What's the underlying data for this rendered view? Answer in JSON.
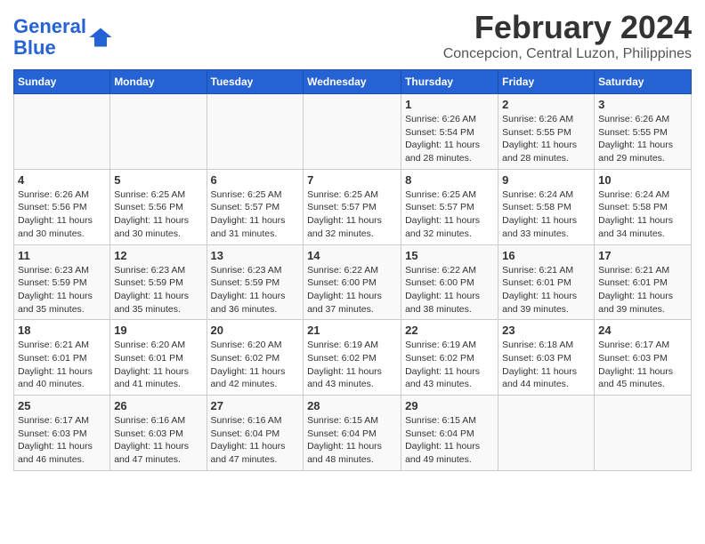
{
  "header": {
    "logo_line1": "General",
    "logo_line2": "Blue",
    "title": "February 2024",
    "subtitle": "Concepcion, Central Luzon, Philippines"
  },
  "days_of_week": [
    "Sunday",
    "Monday",
    "Tuesday",
    "Wednesday",
    "Thursday",
    "Friday",
    "Saturday"
  ],
  "weeks": [
    [
      {
        "day": "",
        "info": ""
      },
      {
        "day": "",
        "info": ""
      },
      {
        "day": "",
        "info": ""
      },
      {
        "day": "",
        "info": ""
      },
      {
        "day": "1",
        "info": "Sunrise: 6:26 AM\nSunset: 5:54 PM\nDaylight: 11 hours\nand 28 minutes."
      },
      {
        "day": "2",
        "info": "Sunrise: 6:26 AM\nSunset: 5:55 PM\nDaylight: 11 hours\nand 28 minutes."
      },
      {
        "day": "3",
        "info": "Sunrise: 6:26 AM\nSunset: 5:55 PM\nDaylight: 11 hours\nand 29 minutes."
      }
    ],
    [
      {
        "day": "4",
        "info": "Sunrise: 6:26 AM\nSunset: 5:56 PM\nDaylight: 11 hours\nand 30 minutes."
      },
      {
        "day": "5",
        "info": "Sunrise: 6:25 AM\nSunset: 5:56 PM\nDaylight: 11 hours\nand 30 minutes."
      },
      {
        "day": "6",
        "info": "Sunrise: 6:25 AM\nSunset: 5:57 PM\nDaylight: 11 hours\nand 31 minutes."
      },
      {
        "day": "7",
        "info": "Sunrise: 6:25 AM\nSunset: 5:57 PM\nDaylight: 11 hours\nand 32 minutes."
      },
      {
        "day": "8",
        "info": "Sunrise: 6:25 AM\nSunset: 5:57 PM\nDaylight: 11 hours\nand 32 minutes."
      },
      {
        "day": "9",
        "info": "Sunrise: 6:24 AM\nSunset: 5:58 PM\nDaylight: 11 hours\nand 33 minutes."
      },
      {
        "day": "10",
        "info": "Sunrise: 6:24 AM\nSunset: 5:58 PM\nDaylight: 11 hours\nand 34 minutes."
      }
    ],
    [
      {
        "day": "11",
        "info": "Sunrise: 6:23 AM\nSunset: 5:59 PM\nDaylight: 11 hours\nand 35 minutes."
      },
      {
        "day": "12",
        "info": "Sunrise: 6:23 AM\nSunset: 5:59 PM\nDaylight: 11 hours\nand 35 minutes."
      },
      {
        "day": "13",
        "info": "Sunrise: 6:23 AM\nSunset: 5:59 PM\nDaylight: 11 hours\nand 36 minutes."
      },
      {
        "day": "14",
        "info": "Sunrise: 6:22 AM\nSunset: 6:00 PM\nDaylight: 11 hours\nand 37 minutes."
      },
      {
        "day": "15",
        "info": "Sunrise: 6:22 AM\nSunset: 6:00 PM\nDaylight: 11 hours\nand 38 minutes."
      },
      {
        "day": "16",
        "info": "Sunrise: 6:21 AM\nSunset: 6:01 PM\nDaylight: 11 hours\nand 39 minutes."
      },
      {
        "day": "17",
        "info": "Sunrise: 6:21 AM\nSunset: 6:01 PM\nDaylight: 11 hours\nand 39 minutes."
      }
    ],
    [
      {
        "day": "18",
        "info": "Sunrise: 6:21 AM\nSunset: 6:01 PM\nDaylight: 11 hours\nand 40 minutes."
      },
      {
        "day": "19",
        "info": "Sunrise: 6:20 AM\nSunset: 6:01 PM\nDaylight: 11 hours\nand 41 minutes."
      },
      {
        "day": "20",
        "info": "Sunrise: 6:20 AM\nSunset: 6:02 PM\nDaylight: 11 hours\nand 42 minutes."
      },
      {
        "day": "21",
        "info": "Sunrise: 6:19 AM\nSunset: 6:02 PM\nDaylight: 11 hours\nand 43 minutes."
      },
      {
        "day": "22",
        "info": "Sunrise: 6:19 AM\nSunset: 6:02 PM\nDaylight: 11 hours\nand 43 minutes."
      },
      {
        "day": "23",
        "info": "Sunrise: 6:18 AM\nSunset: 6:03 PM\nDaylight: 11 hours\nand 44 minutes."
      },
      {
        "day": "24",
        "info": "Sunrise: 6:17 AM\nSunset: 6:03 PM\nDaylight: 11 hours\nand 45 minutes."
      }
    ],
    [
      {
        "day": "25",
        "info": "Sunrise: 6:17 AM\nSunset: 6:03 PM\nDaylight: 11 hours\nand 46 minutes."
      },
      {
        "day": "26",
        "info": "Sunrise: 6:16 AM\nSunset: 6:03 PM\nDaylight: 11 hours\nand 47 minutes."
      },
      {
        "day": "27",
        "info": "Sunrise: 6:16 AM\nSunset: 6:04 PM\nDaylight: 11 hours\nand 47 minutes."
      },
      {
        "day": "28",
        "info": "Sunrise: 6:15 AM\nSunset: 6:04 PM\nDaylight: 11 hours\nand 48 minutes."
      },
      {
        "day": "29",
        "info": "Sunrise: 6:15 AM\nSunset: 6:04 PM\nDaylight: 11 hours\nand 49 minutes."
      },
      {
        "day": "",
        "info": ""
      },
      {
        "day": "",
        "info": ""
      }
    ]
  ]
}
